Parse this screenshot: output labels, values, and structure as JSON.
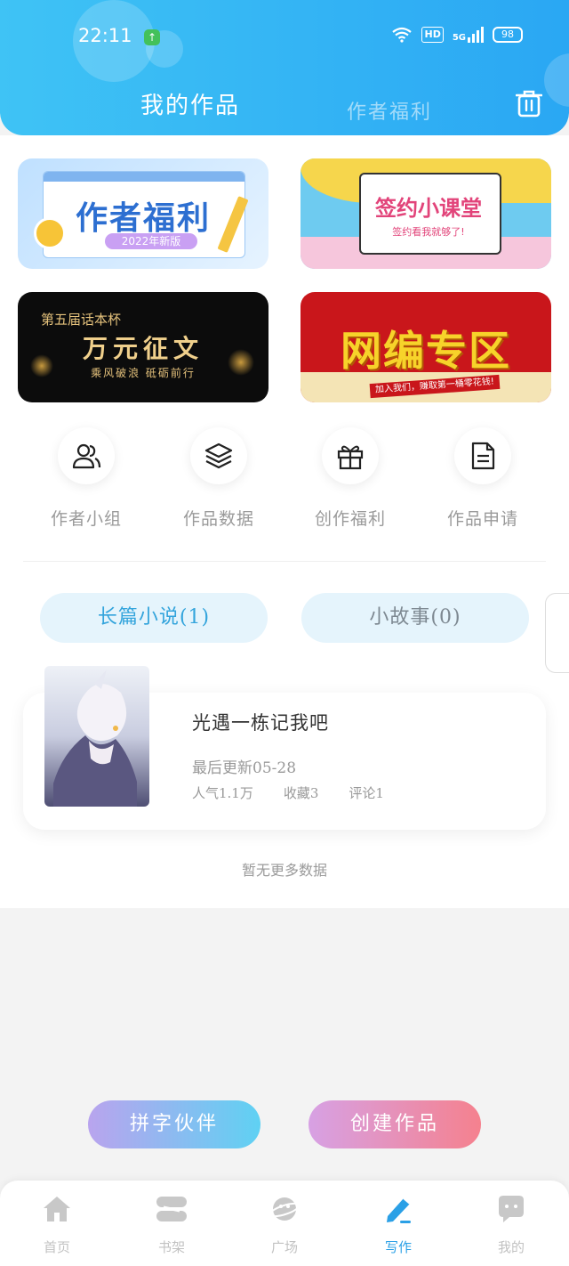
{
  "status_bar": {
    "time": "22:11",
    "network": "5G",
    "hd": "HD",
    "battery": "98"
  },
  "header": {
    "tabs": [
      {
        "label": "我的作品",
        "active": true
      },
      {
        "label": "作者福利",
        "active": false
      }
    ],
    "trash_icon": "trash-icon"
  },
  "banners": [
    {
      "title": "作者福利",
      "subtitle": "2022年新版"
    },
    {
      "title": "签约小课堂",
      "subtitle": "签约看我就够了!"
    },
    {
      "title": "第五届话本杯",
      "subtitle": "万元征文",
      "detail": "乘风破浪 砥砺前行"
    },
    {
      "title": "网编专区",
      "subtitle": "加入我们，赚取第一桶零花钱!"
    }
  ],
  "features": [
    {
      "label": "作者小组",
      "icon": "users-icon"
    },
    {
      "label": "作品数据",
      "icon": "layers-icon"
    },
    {
      "label": "创作福利",
      "icon": "gift-icon"
    },
    {
      "label": "作品申请",
      "icon": "document-icon"
    }
  ],
  "segments": [
    {
      "label": "长篇小说(1)",
      "active": true
    },
    {
      "label": "小故事(0)",
      "active": false
    }
  ],
  "work": {
    "title": "光遇一栋记我吧",
    "updated": "最后更新05-28",
    "popularity": "人气1.1万",
    "favorites": "收藏3",
    "comments": "评论1"
  },
  "empty_text": "暂无更多数据",
  "actions": {
    "partner": "拼字伙伴",
    "create": "创建作品"
  },
  "bottom_nav": [
    {
      "label": "首页",
      "icon": "home-icon"
    },
    {
      "label": "书架",
      "icon": "bookshelf-icon"
    },
    {
      "label": "广场",
      "icon": "planet-icon"
    },
    {
      "label": "写作",
      "icon": "pen-icon",
      "active": true
    },
    {
      "label": "我的",
      "icon": "chat-icon"
    }
  ],
  "colors": {
    "header_start": "#3fc3f5",
    "header_end": "#2aa7f3",
    "accent": "#2ba0e6"
  }
}
